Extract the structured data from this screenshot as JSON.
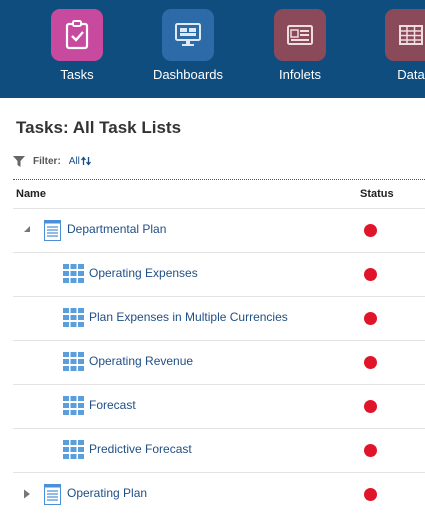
{
  "nav": {
    "items": [
      {
        "label": "Tasks",
        "icon": "task-clipboard-icon",
        "color": "#c74a9e",
        "opacity": 1
      },
      {
        "label": "Dashboards",
        "icon": "dashboard-monitor-icon",
        "color": "#2c6aa8",
        "opacity": 1
      },
      {
        "label": "Infolets",
        "icon": "infolet-card-icon",
        "color": "#8a4a59",
        "opacity": 1
      },
      {
        "label": "Data",
        "icon": "data-grid-icon",
        "color": "#8a4a59",
        "opacity": 1
      }
    ]
  },
  "page": {
    "title": "Tasks: All Task Lists"
  },
  "filter": {
    "label": "Filter:",
    "value": "All"
  },
  "columns": {
    "name": "Name",
    "status": "Status"
  },
  "colors": {
    "status_red": "#e0152a",
    "link": "#1f4f85",
    "topbar": "#0f4d7f"
  },
  "rows": [
    {
      "label": "Departmental Plan",
      "level": 0,
      "type": "task-list",
      "expanded": true,
      "status": "red"
    },
    {
      "label": "Operating Expenses",
      "level": 1,
      "type": "task",
      "status": "red"
    },
    {
      "label": "Plan Expenses in Multiple Currencies",
      "level": 1,
      "type": "task",
      "status": "red"
    },
    {
      "label": "Operating Revenue",
      "level": 1,
      "type": "task",
      "status": "red"
    },
    {
      "label": "Forecast",
      "level": 1,
      "type": "task",
      "status": "red"
    },
    {
      "label": "Predictive Forecast",
      "level": 1,
      "type": "task",
      "status": "red"
    },
    {
      "label": "Operating Plan",
      "level": 0,
      "type": "task-list",
      "expanded": false,
      "status": "red"
    }
  ]
}
